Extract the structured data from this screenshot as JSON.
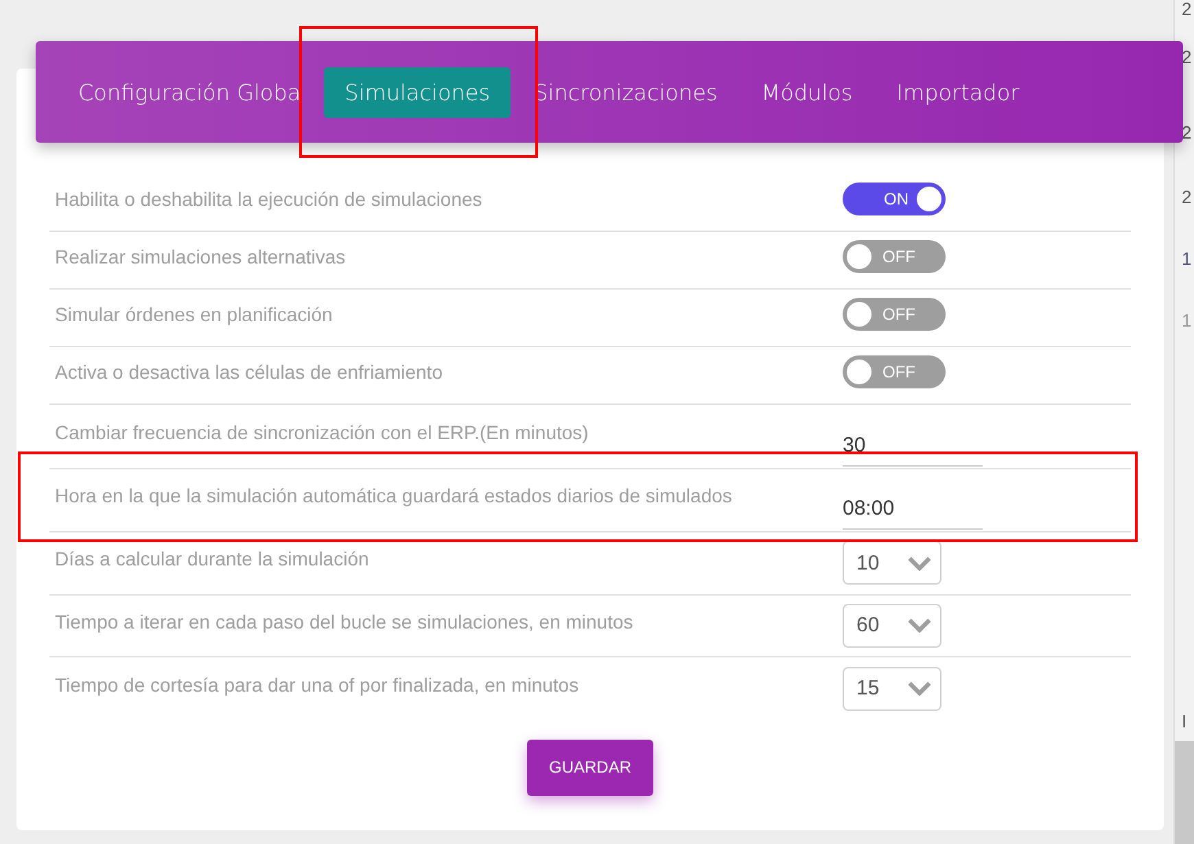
{
  "tabs": [
    {
      "label": "Configuración Globa",
      "selected": false
    },
    {
      "label": "Simulaciones",
      "selected": true
    },
    {
      "label": "Sincronizaciones",
      "selected": false
    },
    {
      "label": "Módulos",
      "selected": false
    },
    {
      "label": "Importador",
      "selected": false
    }
  ],
  "settings": [
    {
      "kind": "toggle",
      "label": "Habilita o deshabilita la ejecución de simulaciones",
      "on": true,
      "state_text": "ON"
    },
    {
      "kind": "toggle",
      "label": "Realizar simulaciones alternativas",
      "on": false,
      "state_text": "OFF"
    },
    {
      "kind": "toggle",
      "label": "Simular órdenes en planificación",
      "on": false,
      "state_text": "OFF"
    },
    {
      "kind": "toggle",
      "label": "Activa o desactiva las células de enfriamiento",
      "on": false,
      "state_text": "OFF"
    },
    {
      "kind": "text",
      "label": "Cambiar frecuencia de sincronización con el ERP.(En minutos)",
      "value": "30"
    },
    {
      "kind": "text",
      "label": "Hora en la que la simulación automática guardará estados diarios de simulados",
      "value": "08:00"
    },
    {
      "kind": "select",
      "label": "Días a calcular durante la simulación",
      "value": "10"
    },
    {
      "kind": "select",
      "label": "Tiempo a iterar en cada paso del bucle se simulaciones, en minutos",
      "value": "60"
    },
    {
      "kind": "select",
      "label": "Tiempo de cortesía para dar una of por finalizada, en minutos",
      "value": "15"
    }
  ],
  "save_button": "GUARDAR",
  "side_strip": [
    "2",
    "2",
    "2",
    "2",
    "1",
    "1",
    "I"
  ]
}
